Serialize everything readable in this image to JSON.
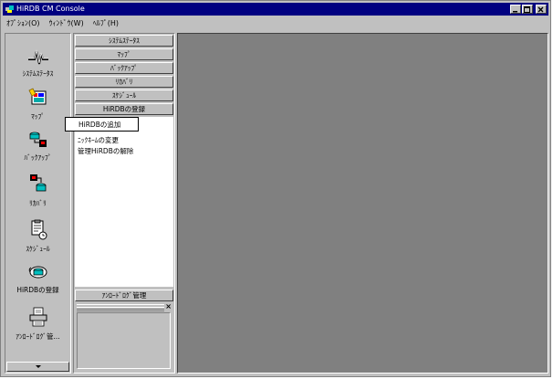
{
  "window": {
    "title": "HiRDB CM Console"
  },
  "menubar": {
    "items": [
      "ｵﾌﾟｼｮﾝ(O)",
      "ｳｨﾝﾄﾞｳ(W)",
      "ﾍﾙﾌﾟ(H)"
    ]
  },
  "iconbar": {
    "items": [
      {
        "label": "ｼｽﾃﾑｽﾃｰﾀｽ",
        "icon": "system-status-icon"
      },
      {
        "label": "ﾏｯﾌﾟ",
        "icon": "map-icon"
      },
      {
        "label": "ﾊﾞｯｸｱｯﾌﾟ",
        "icon": "backup-icon"
      },
      {
        "label": "ﾘｶﾊﾞﾘ",
        "icon": "recovery-icon"
      },
      {
        "label": "ｽｹｼﾞｭｰﾙ",
        "icon": "schedule-icon"
      },
      {
        "label": "HiRDBの登録",
        "icon": "hirdb-register-icon"
      },
      {
        "label": "ｱﾝﾛｰﾄﾞﾛｸﾞ管...",
        "icon": "unload-log-icon"
      }
    ]
  },
  "panel": {
    "categories": [
      "ｼｽﾃﾑｽﾃｰﾀｽ",
      "ﾏｯﾌﾟ",
      "ﾊﾞｯｸｱｯﾌﾟ",
      "ﾘｶﾊﾞﾘ",
      "ｽｹｼﾞｭｰﾙ",
      "HiRDBの登録"
    ],
    "tasks": [
      "HiRDBの追加",
      "ﾆｯｸﾈｰﾑの変更",
      "管理HiRDBの解除"
    ],
    "bottom_category": "ｱﾝﾛｰﾄﾞﾛｸﾞ管理",
    "subpane_close": "×"
  },
  "colors": {
    "face": "#c0c0c0",
    "titlebar": "#000080",
    "workspace": "#808080"
  }
}
